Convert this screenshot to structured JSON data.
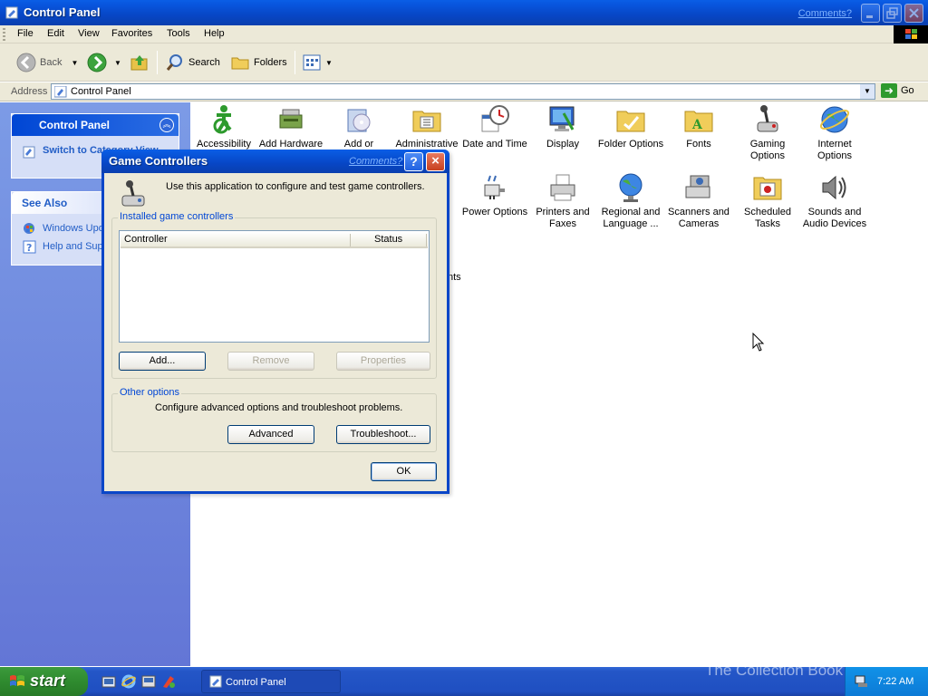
{
  "window": {
    "title": "Control Panel",
    "comments_link": "Comments?"
  },
  "menu": [
    "File",
    "Edit",
    "View",
    "Favorites",
    "Tools",
    "Help"
  ],
  "toolbar": {
    "back": "Back",
    "search": "Search",
    "folders": "Folders"
  },
  "address": {
    "label": "Address",
    "value": "Control Panel",
    "go": "Go"
  },
  "task_pane": {
    "control_panel_title": "Control Panel",
    "switch_view": "Switch to Category View",
    "see_also_title": "See Also",
    "see_also_items": [
      "Windows Update",
      "Help and Support"
    ]
  },
  "icons": [
    {
      "label": "Accessibility Options",
      "icon": "accessibility-icon"
    },
    {
      "label": "Add Hardware",
      "icon": "add-hardware-icon"
    },
    {
      "label": "Add or Remove Programs",
      "icon": "add-remove-programs-icon"
    },
    {
      "label": "Administrative Tools",
      "icon": "administrative-tools-icon"
    },
    {
      "label": "Date and Time",
      "icon": "date-time-icon"
    },
    {
      "label": "Display",
      "icon": "display-icon"
    },
    {
      "label": "Folder Options",
      "icon": "folder-options-icon"
    },
    {
      "label": "Fonts",
      "icon": "fonts-icon"
    },
    {
      "label": "Gaming Options",
      "icon": "gaming-options-icon"
    },
    {
      "label": "Internet Options",
      "icon": "internet-options-icon"
    },
    {
      "label": "Power Options",
      "icon": "power-options-icon"
    },
    {
      "label": "Printers and Faxes",
      "icon": "printers-faxes-icon"
    },
    {
      "label": "Regional and Language ...",
      "icon": "regional-language-icon"
    },
    {
      "label": "Scanners and Cameras",
      "icon": "scanners-cameras-icon"
    },
    {
      "label": "Scheduled Tasks",
      "icon": "scheduled-tasks-icon"
    },
    {
      "label": "Sounds and Audio Devices",
      "icon": "sounds-audio-icon"
    }
  ],
  "hidden_label_fragments": [
    "l",
    "nts"
  ],
  "dialog": {
    "title": "Game Controllers",
    "comments_link": "Comments?",
    "help": "?",
    "close": "×",
    "description": "Use this application to configure and test game controllers.",
    "installed_group": "Installed game controllers",
    "columns": [
      "Controller",
      "Status"
    ],
    "rows": [],
    "add": "Add...",
    "remove": "Remove",
    "properties": "Properties",
    "other_group": "Other options",
    "other_desc": "Configure advanced options and troubleshoot problems.",
    "advanced": "Advanced",
    "troubleshoot": "Troubleshoot...",
    "ok": "OK"
  },
  "taskbar": {
    "start": "start",
    "task_label": "Control Panel",
    "clock": "7:22 AM",
    "watermark": "The Collection Book"
  },
  "colors": {
    "xp_blue": "#0a5ee6",
    "task_pane": "#7c9be6",
    "dialog_face": "#ece9d8",
    "link_blue": "#215dc6",
    "start_green": "#3c9a3c"
  }
}
